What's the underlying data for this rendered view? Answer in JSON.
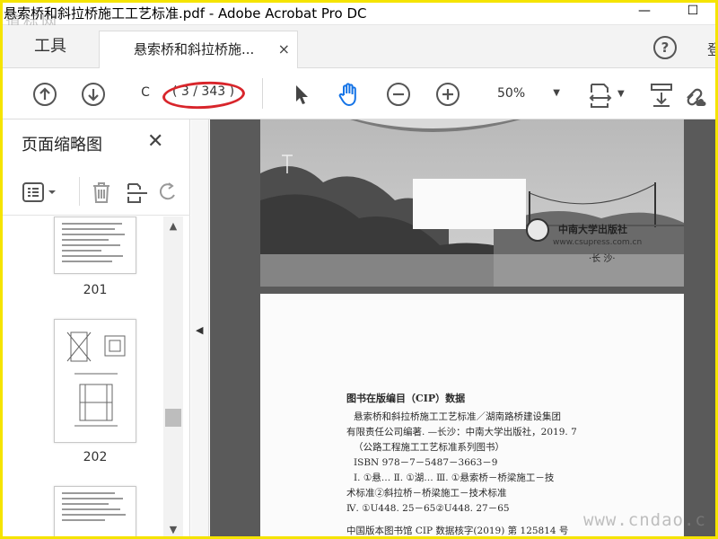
{
  "window": {
    "title": "悬索桥和斜拉桥施工工艺标准.pdf - Adobe Acrobat Pro DC",
    "watermark_top": "道标网",
    "minimize": "—",
    "maximize": "☐"
  },
  "tabs": {
    "tools_label": "工具",
    "doc_label": "悬索桥和斜拉桥施...",
    "doc_close": "×",
    "help": "?",
    "login_partial": "登"
  },
  "toolbar": {
    "page_current": "C",
    "page_total": "( 3 / 343 )",
    "zoom_value": "50%",
    "zoom_caret": "▼"
  },
  "left_panel": {
    "title": "页面缩略图",
    "close": "✕",
    "thumbnails": [
      {
        "label": "201"
      },
      {
        "label": "202"
      },
      {
        "label": ""
      }
    ],
    "scroll_up": "▲",
    "scroll_down": "▼"
  },
  "splitter_arrow": "◀",
  "document": {
    "publisher_name": "中南大学出版社",
    "publisher_url": "www.csupress.com.cn",
    "publisher_city": "·长 沙·",
    "cip_heading": "图书在版编目（CIP）数据",
    "cip_lines": [
      "悬索桥和斜拉桥施工工艺标准／湖南路桥建设集团",
      "有限责任公司编著. —长沙：中南大学出版社，2019. 7",
      "（公路工程施工工艺标准系列图书）",
      "ISBN 978－7－5487－3663－9",
      "Ⅰ. ①悬…  Ⅱ. ①湖…  Ⅲ. ①悬索桥－桥梁施工－技",
      "术标准②斜拉桥－桥梁施工－技术标准",
      "Ⅳ. ①U448. 25－65②U448. 27－65",
      "中国版本图书馆 CIP 数据核字(2019) 第 125814 号"
    ]
  },
  "watermark_bottom": "www.cndao.c",
  "colors": {
    "accent_blue": "#1473e6",
    "highlight_red": "#d8252b",
    "frame_yellow": "#f5e400"
  },
  "icons": [
    "prev-page-icon",
    "next-page-icon",
    "select-cursor-icon",
    "hand-tool-icon",
    "zoom-out-icon",
    "zoom-in-icon",
    "page-fit-icon",
    "scroll-mode-icon",
    "link-tool-icon",
    "thumbnail-options-icon",
    "delete-icon",
    "extract-icon",
    "rotate-icon"
  ]
}
